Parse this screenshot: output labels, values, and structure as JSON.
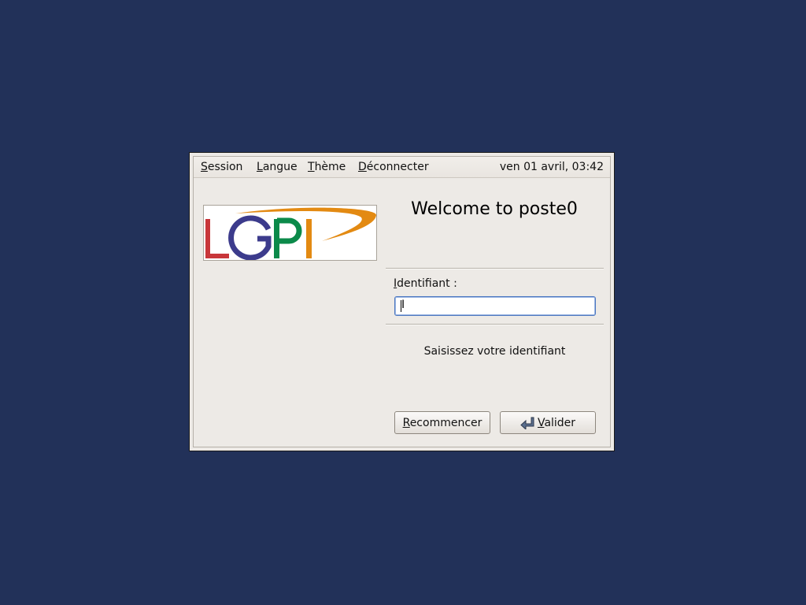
{
  "menubar": {
    "items": [
      {
        "mnemonic": "S",
        "rest": "ession"
      },
      {
        "mnemonic": "L",
        "rest": "angue"
      },
      {
        "mnemonic": "T",
        "rest": "hème"
      },
      {
        "mnemonic": "D",
        "rest": "éconnecter"
      }
    ],
    "clock": "ven 01 avril, 03:42"
  },
  "logo": {
    "text": "LGPI",
    "colors": {
      "L": "#c8363a",
      "G": "#3c3b8c",
      "P": "#0b8a4a",
      "I": "#e38a12",
      "swoosh": "#e38a12"
    }
  },
  "welcome": "Welcome to poste0",
  "login": {
    "label_mnemonic": "I",
    "label_rest": "dentifiant :",
    "value": "",
    "prompt": "Saisissez votre identifiant"
  },
  "buttons": {
    "reset": {
      "mnemonic": "R",
      "rest": "ecommencer"
    },
    "ok": {
      "mnemonic": "V",
      "rest": "alider",
      "icon": "enter-key-icon"
    }
  },
  "colors": {
    "desktop": "#223159",
    "dialog": "#edeae6",
    "focus": "#4d78c0"
  }
}
